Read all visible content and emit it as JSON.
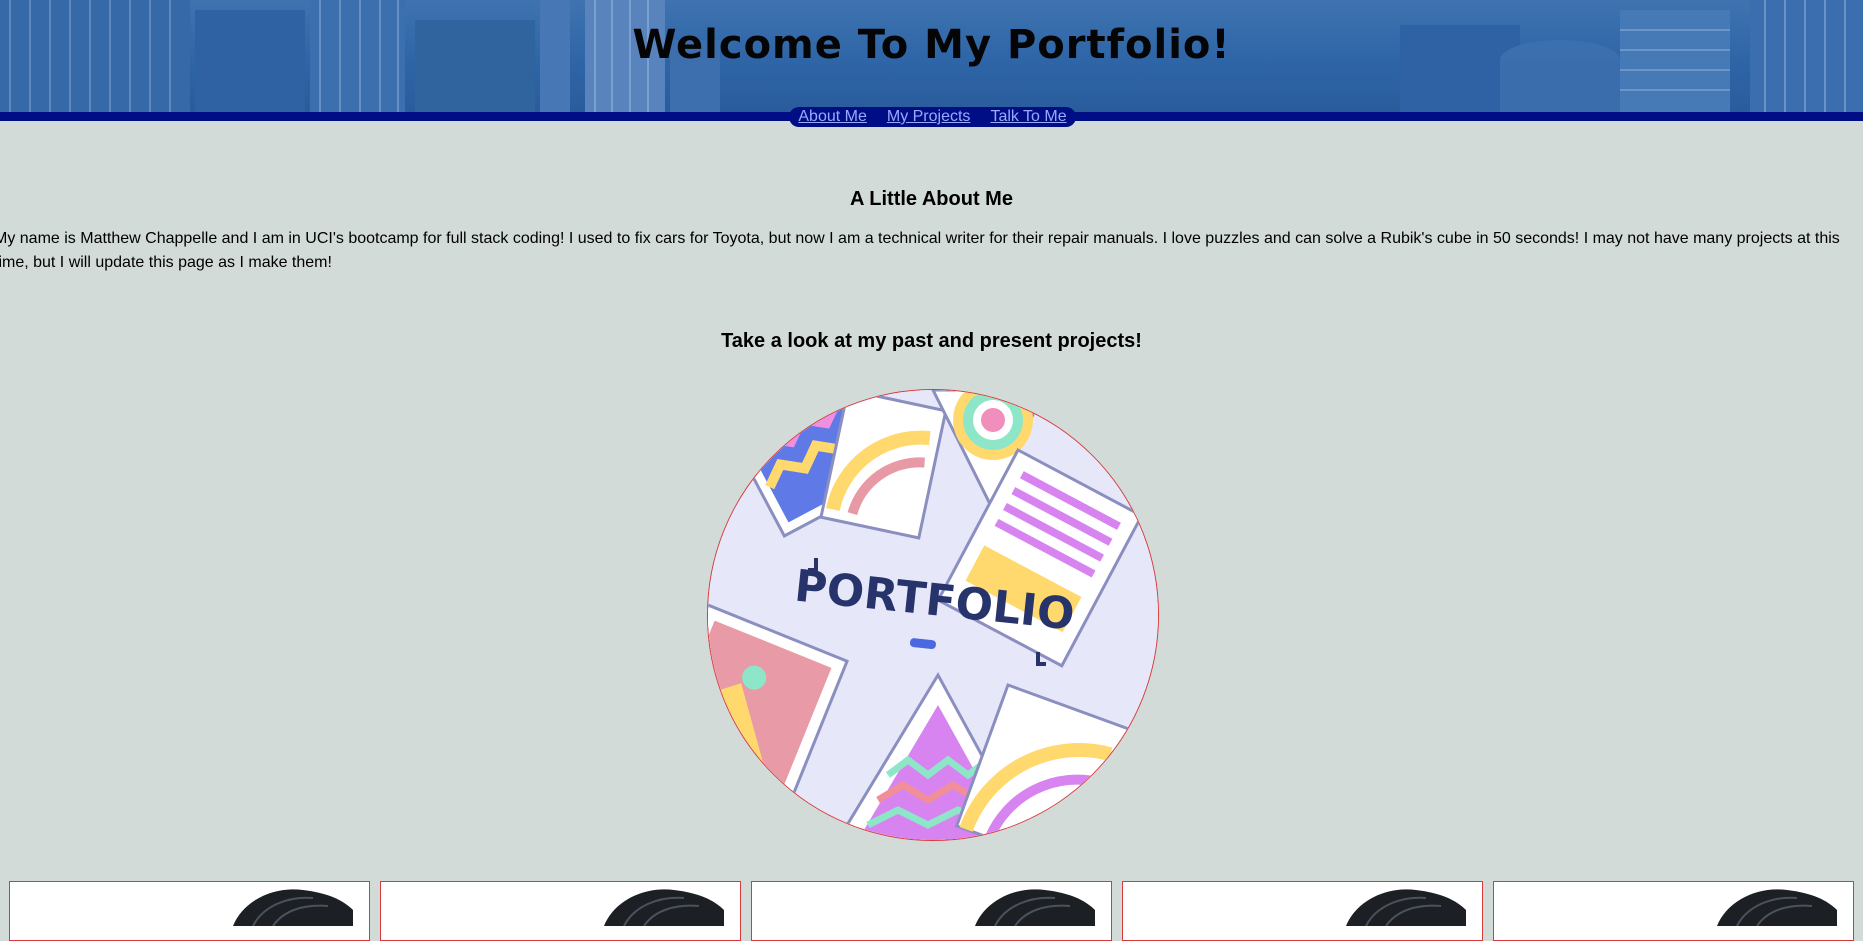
{
  "header": {
    "title": "Welcome To My Portfolio!"
  },
  "nav": {
    "items": [
      {
        "label": "About Me"
      },
      {
        "label": "My Projects"
      },
      {
        "label": "Talk To Me"
      }
    ]
  },
  "about": {
    "heading": "A Little About Me",
    "text": "My name is Matthew Chappelle and I am in UCI's bootcamp for full stack coding! I used to fix cars for Toyota, but now I am a technical writer for their repair manuals. I love puzzles and can solve a Rubik's cube in 50 seconds! I may not have many projects at this time, but I will update this page as I make them!"
  },
  "projects": {
    "heading": "Take a look at my past and present projects!",
    "portfolio_image_text": "PORTFOLIO",
    "cards": [
      {
        "icon": "hair-icon"
      },
      {
        "icon": "hair-icon"
      },
      {
        "icon": "hair-icon"
      },
      {
        "icon": "hair-icon"
      },
      {
        "icon": "hair-icon"
      }
    ]
  },
  "colors": {
    "page_background": "#d3dbd9",
    "header_blue": "#2d64a6",
    "nav_bar": "#000e86",
    "nav_link": "#9aa9ff",
    "card_border": "#d83a3a"
  }
}
